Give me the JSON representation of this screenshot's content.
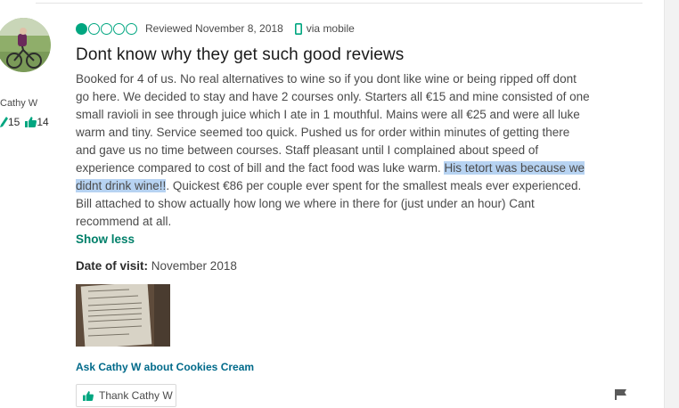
{
  "member": {
    "name": "Cathy W",
    "contributions": "15",
    "helpful_votes": "14"
  },
  "review": {
    "rating": 1,
    "rating_max": 5,
    "reviewed_date": "Reviewed November 8, 2018",
    "device": "via mobile",
    "title": "Dont know why they get such good reviews",
    "body_before": "Booked for 4 of us. No real alternatives to wine so if you dont like wine or being ripped off dont go here. We decided to stay and have 2 courses only. Starters all €15 and mine consisted of one small ravioli in see through juice which I ate in 1 mouthful. Mains were all €25 and were all luke warm and tiny. Service seemed too quick. Pushed us for order within minutes of getting there and gave us no time between courses. Staff pleasant until I complained about speed of experience compared to cost of bill and the fact food was luke warm. ",
    "body_highlight": "His tetort was because we didnt drink wine!!",
    "body_after": ". Quickest €86 per couple ever spent for the smallest meals ever experienced. Bill attached to show actually how long we where in there for (just under an hour) Cant recommend at all.",
    "show_less": "Show less",
    "visit_label": "Date of visit:",
    "visit_value": "November 2018",
    "ask_link": "Ask Cathy W about Cookies Cream",
    "thank_button": "Thank Cathy W"
  },
  "colors": {
    "bubble": "#00a680",
    "link": "#006a8a",
    "show_less": "#00806a",
    "highlight": "#b7d3f2"
  }
}
